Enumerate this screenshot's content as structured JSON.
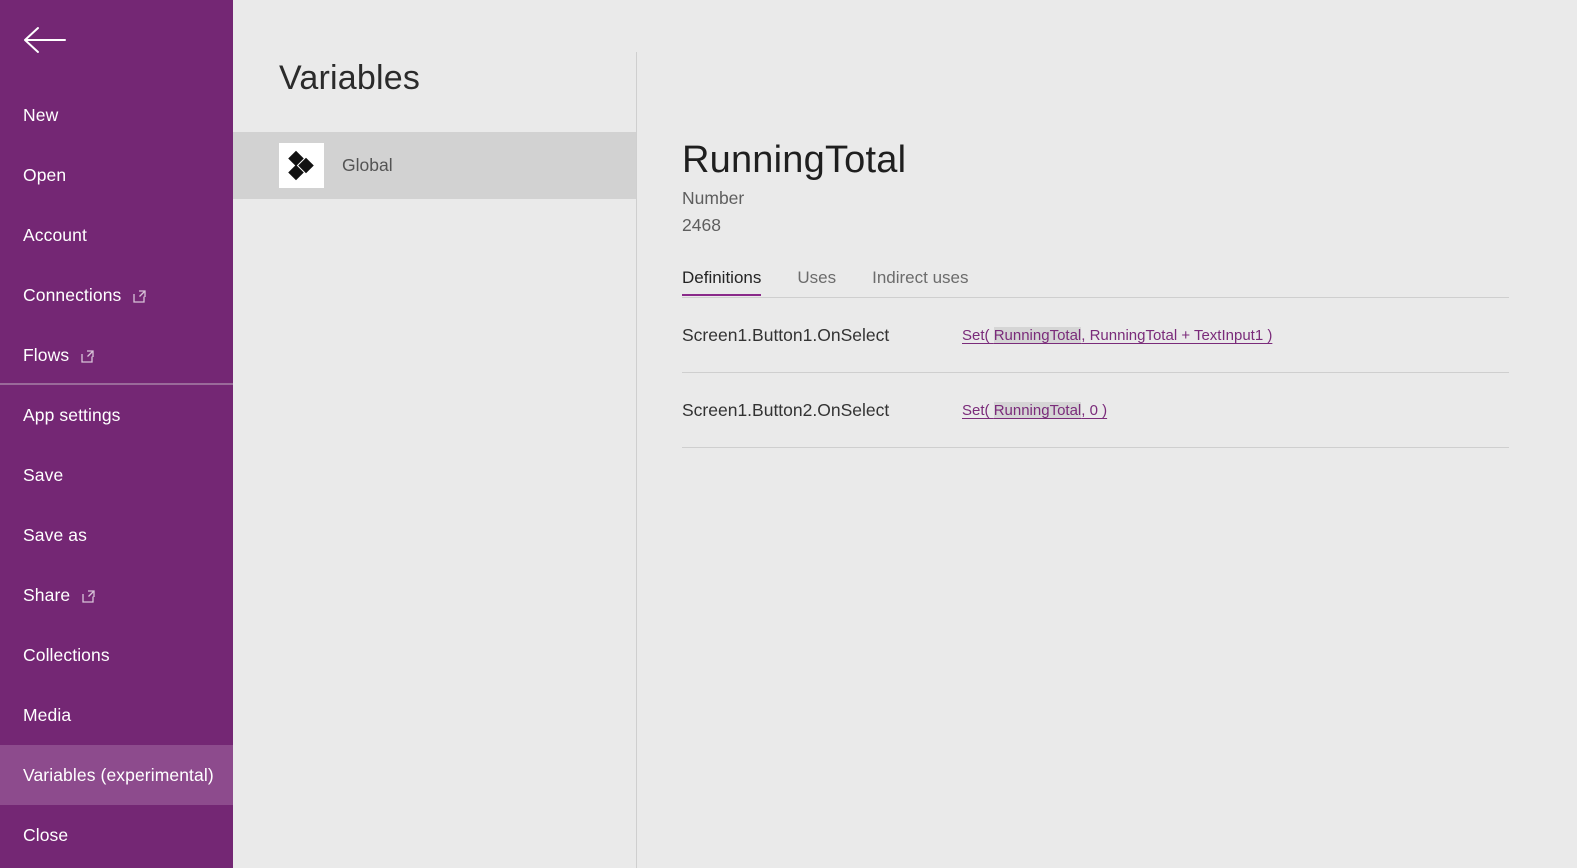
{
  "sidebar": {
    "back_icon": "back-arrow-icon",
    "accent_color": "#742774",
    "selected_color": "#8d4b8d",
    "items": [
      {
        "label": "New",
        "external": false,
        "selected": false,
        "group_end": false
      },
      {
        "label": "Open",
        "external": false,
        "selected": false,
        "group_end": false
      },
      {
        "label": "Account",
        "external": false,
        "selected": false,
        "group_end": false
      },
      {
        "label": "Connections",
        "external": true,
        "selected": false,
        "group_end": false
      },
      {
        "label": "Flows",
        "external": true,
        "selected": false,
        "group_end": true
      },
      {
        "label": "App settings",
        "external": false,
        "selected": false,
        "group_end": false
      },
      {
        "label": "Save",
        "external": false,
        "selected": false,
        "group_end": false
      },
      {
        "label": "Save as",
        "external": false,
        "selected": false,
        "group_end": false
      },
      {
        "label": "Share",
        "external": true,
        "selected": false,
        "group_end": false
      },
      {
        "label": "Collections",
        "external": false,
        "selected": false,
        "group_end": false
      },
      {
        "label": "Media",
        "external": false,
        "selected": false,
        "group_end": false
      },
      {
        "label": "Variables (experimental)",
        "external": false,
        "selected": true,
        "group_end": false
      },
      {
        "label": "Close",
        "external": false,
        "selected": false,
        "group_end": false
      }
    ]
  },
  "list_pane": {
    "title": "Variables",
    "items": [
      {
        "label": "Global",
        "icon": "global-variable-icon",
        "selected": true
      }
    ]
  },
  "detail": {
    "title": "RunningTotal",
    "type": "Number",
    "value": "2468",
    "tabs": [
      {
        "label": "Definitions",
        "active": true
      },
      {
        "label": "Uses",
        "active": false
      },
      {
        "label": "Indirect uses",
        "active": false
      }
    ],
    "accent_color": "#8a2a8a",
    "link_color": "#7a2b7a",
    "rows": [
      {
        "property": "Screen1.Button1.OnSelect",
        "formula_prefix": "Set( ",
        "formula_highlight": "RunningTotal",
        "formula_suffix": ", RunningTotal + TextInput1 )"
      },
      {
        "property": "Screen1.Button2.OnSelect",
        "formula_prefix": "Set( ",
        "formula_highlight": "RunningTotal",
        "formula_suffix": ", 0 )"
      }
    ]
  }
}
